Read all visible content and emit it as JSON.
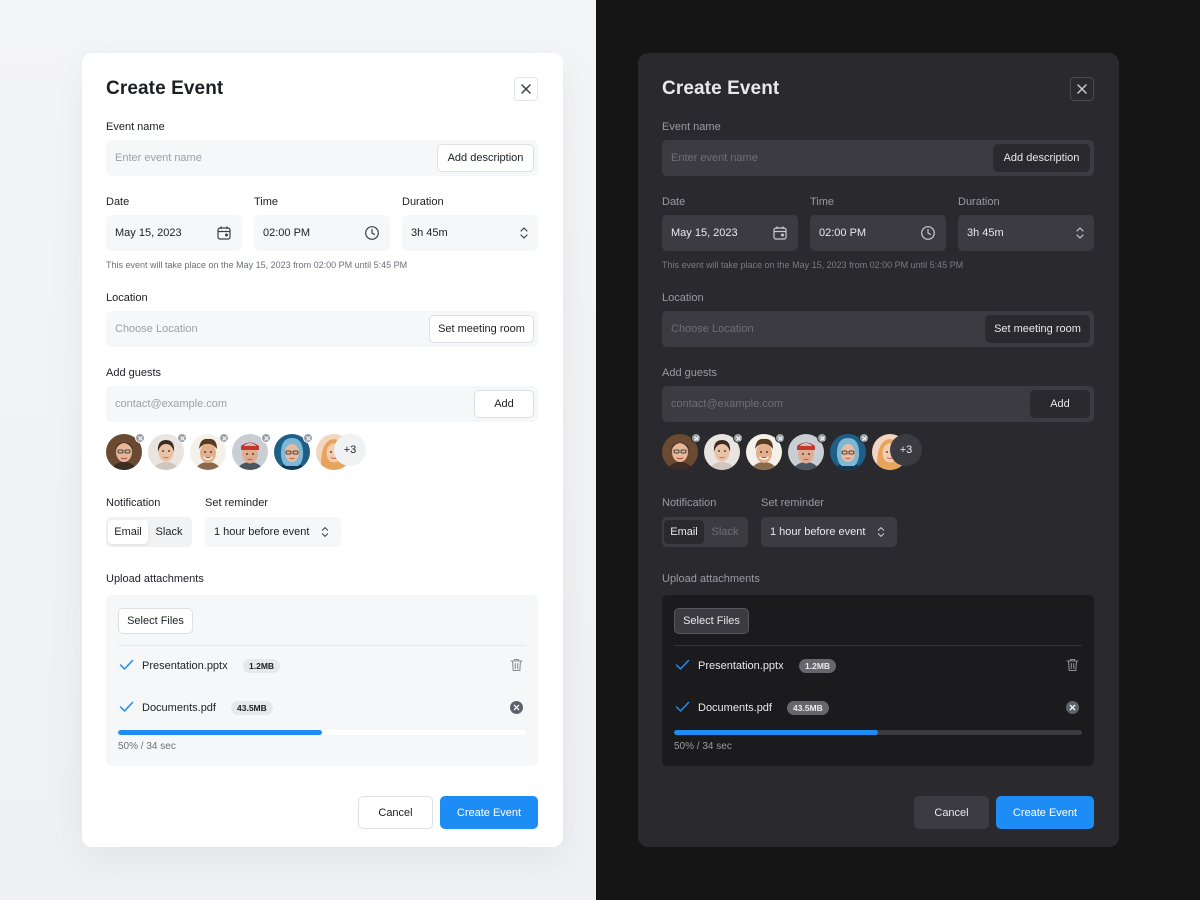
{
  "modal": {
    "title": "Create Event",
    "event_name": {
      "label": "Event name",
      "placeholder": "Enter event name",
      "description_button": "Add description"
    },
    "date": {
      "label": "Date",
      "value": "May 15, 2023",
      "icon": "calendar-icon"
    },
    "time": {
      "label": "Time",
      "value": "02:00 PM",
      "icon": "clock-icon"
    },
    "duration": {
      "label": "Duration",
      "value": "3h 45m",
      "icon": "chevron-up-down-icon"
    },
    "schedule_hint": "This event will take place on the May 15, 2023 from 02:00 PM until 5:45 PM",
    "location": {
      "label": "Location",
      "placeholder": "Choose Location",
      "button": "Set meeting room"
    },
    "guests": {
      "label": "Add guests",
      "placeholder": "contact@example.com",
      "add_button": "Add",
      "more_count": "+3"
    },
    "notification": {
      "label": "Notification",
      "options": [
        "Email",
        "Slack"
      ],
      "selected": "Email"
    },
    "reminder": {
      "label": "Set reminder",
      "value": "1 hour before event"
    },
    "attachments": {
      "label": "Upload attachments",
      "select_button": "Select Files",
      "files": [
        {
          "name": "Presentation.pptx",
          "size": "1.2MB",
          "action_icon": "trash-icon"
        },
        {
          "name": "Documents.pdf",
          "size": "43.5MB",
          "action_icon": "cancel-circle-icon"
        }
      ],
      "progress_fraction": 0.5,
      "progress_text": "50% / 34 sec"
    },
    "cancel_button": "Cancel",
    "create_button": "Create Event"
  },
  "colors": {
    "accent": "#1e8cf5",
    "dark_modal_bg": "#2a2a2e",
    "light_modal_bg": "#ffffff"
  }
}
